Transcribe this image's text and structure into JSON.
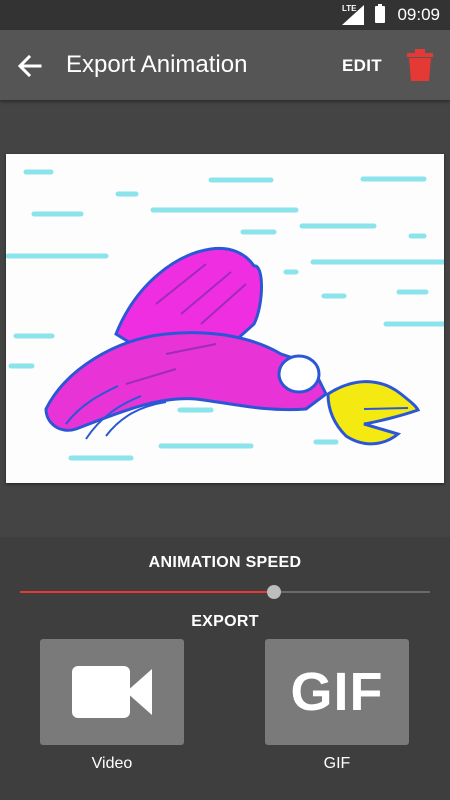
{
  "status_bar": {
    "network": "LTE",
    "time": "09:09"
  },
  "app_bar": {
    "title": "Export Animation",
    "edit_label": "EDIT",
    "back_icon": "arrow-left-icon",
    "delete_icon": "trash-icon"
  },
  "canvas": {
    "drawing": "bird-drawing"
  },
  "animation_speed": {
    "label": "ANIMATION SPEED",
    "value_fraction": 0.62,
    "accent_color": "#e53935"
  },
  "export": {
    "label": "EXPORT",
    "options": [
      {
        "label": "Video",
        "icon": "videocam-icon"
      },
      {
        "label": "GIF",
        "icon_text": "GIF"
      }
    ]
  },
  "colors": {
    "app_bar": "#555555",
    "background": "#444444",
    "panel": "#3e3e3e",
    "tile": "#7a7a7a",
    "delete_icon": "#e53935"
  }
}
